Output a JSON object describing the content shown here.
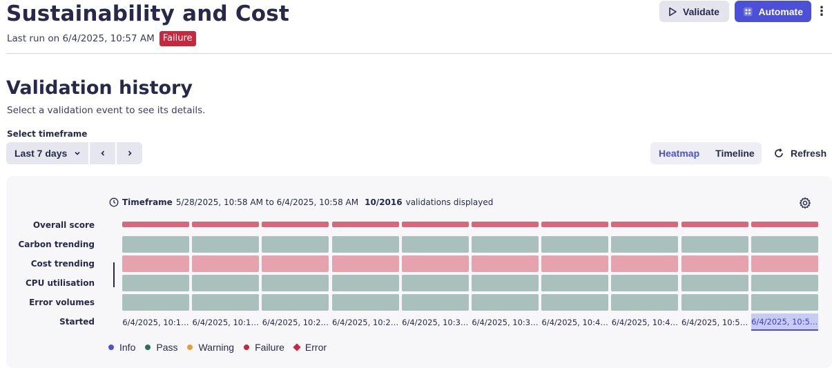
{
  "header": {
    "title": "Sustainability and Cost",
    "last_run": "Last run on 6/4/2025, 10:57 AM",
    "status_badge": "Failure",
    "validate_label": "Validate",
    "automate_label": "Automate"
  },
  "history": {
    "title": "Validation history",
    "subtitle": "Select a validation event to see its details.",
    "timeframe_label": "Select timeframe",
    "timeframe_value": "Last 7 days",
    "view_heatmap": "Heatmap",
    "view_timeline": "Timeline",
    "active_view": "Heatmap",
    "refresh_label": "Refresh"
  },
  "heatmap": {
    "timeframe_prefix": "Timeframe",
    "timeframe_range": "5/28/2025, 10:58 AM to 6/4/2025, 10:58 AM",
    "count": "10/2016",
    "count_suffix": "validations displayed",
    "rows": [
      {
        "label": "Overall score",
        "statuses": [
          "failure",
          "failure",
          "failure",
          "failure",
          "failure",
          "failure",
          "failure",
          "failure",
          "failure",
          "failure"
        ]
      },
      {
        "label": "Carbon trending",
        "statuses": [
          "pass",
          "pass",
          "pass",
          "pass",
          "pass",
          "pass",
          "pass",
          "pass",
          "pass",
          "pass"
        ]
      },
      {
        "label": "Cost trending",
        "statuses": [
          "failure",
          "failure",
          "failure",
          "failure",
          "failure",
          "failure",
          "failure",
          "failure",
          "failure",
          "failure"
        ]
      },
      {
        "label": "CPU utilisation",
        "statuses": [
          "pass",
          "pass",
          "pass",
          "pass",
          "pass",
          "pass",
          "pass",
          "pass",
          "pass",
          "pass"
        ]
      },
      {
        "label": "Error volumes",
        "statuses": [
          "pass",
          "pass",
          "pass",
          "pass",
          "pass",
          "pass",
          "pass",
          "pass",
          "pass",
          "pass"
        ]
      }
    ],
    "started_label": "Started",
    "started": [
      "6/4/2025, 10:1…",
      "6/4/2025, 10:1…",
      "6/4/2025, 10:2…",
      "6/4/2025, 10:2…",
      "6/4/2025, 10:3…",
      "6/4/2025, 10:3…",
      "6/4/2025, 10:4…",
      "6/4/2025, 10:4…",
      "6/4/2025, 10:5…",
      "6/4/2025, 10:5…"
    ],
    "selected_index": 9
  },
  "legend": [
    {
      "label": "Info",
      "color": "#4b50d6",
      "shape": "dot"
    },
    {
      "label": "Pass",
      "color": "#2e6e5e",
      "shape": "dot"
    },
    {
      "label": "Warning",
      "color": "#e3a13a",
      "shape": "dot"
    },
    {
      "label": "Failure",
      "color": "#c8283e",
      "shape": "dot"
    },
    {
      "label": "Error",
      "color": "#c8283e",
      "shape": "diamond"
    }
  ]
}
